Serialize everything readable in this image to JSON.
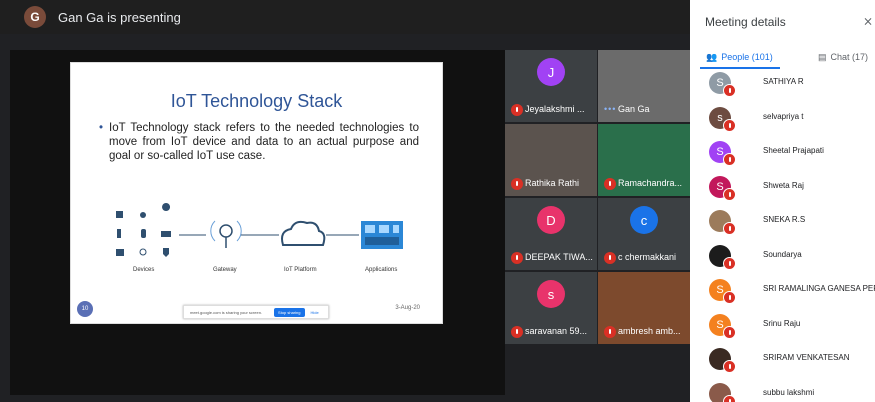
{
  "presenter": {
    "initial": "G",
    "text": "Gan Ga is presenting"
  },
  "slide": {
    "title": "IoT Technology Stack",
    "bullet": "IoT Technology stack refers to the needed technologies to move from IoT device and data to an actual purpose and goal or so-called IoT use case.",
    "labels": {
      "devices": "Devices",
      "gateway": "Gateway",
      "platform": "IoT Platform",
      "applications": "Applications"
    },
    "page_number": "10",
    "date": "3-Aug-20"
  },
  "share_bar": {
    "text": "meet.google.com is sharing your screen.",
    "stop": "Stop sharing",
    "hide": "Hide"
  },
  "tiles": [
    {
      "name": "Jeyalakshmi ...",
      "initial": "J",
      "color": "#a142f4",
      "muted": true
    },
    {
      "name": "Gan Ga",
      "initial": "",
      "color": "#6b6b6b",
      "muted": false,
      "speaking": true
    },
    {
      "name": "Rathika Rathi",
      "initial": "",
      "color": "#5b534e",
      "muted": true
    },
    {
      "name": "Ramachandra...",
      "initial": "",
      "color": "#2a6f4b",
      "muted": true
    },
    {
      "name": "DEEPAK TIWA...",
      "initial": "D",
      "color": "#e8336b",
      "muted": true
    },
    {
      "name": "c chermakkani",
      "initial": "c",
      "color": "#1a73e8",
      "muted": true
    },
    {
      "name": "saravanan 59...",
      "initial": "s",
      "color": "#e8336b",
      "muted": true
    },
    {
      "name": "ambresh amb...",
      "initial": "",
      "color": "#7d4a2d",
      "muted": true
    }
  ],
  "panel": {
    "title": "Meeting details",
    "tabs": {
      "people": "People (101)",
      "chat": "Chat (17)"
    },
    "people": [
      {
        "name": "SATHIYA R",
        "initial": "S",
        "color": "#8f9ba5"
      },
      {
        "name": "selvapriya t",
        "initial": "s",
        "color": "#6d4c41"
      },
      {
        "name": "Sheetal Prajapati",
        "initial": "S",
        "color": "#a142f4"
      },
      {
        "name": "Shweta Raj",
        "initial": "S",
        "color": "#c2185b"
      },
      {
        "name": "SNEKA R.S",
        "initial": "",
        "color": "#9c7b5b"
      },
      {
        "name": "Soundarya",
        "initial": "",
        "color": "#1c1c1c"
      },
      {
        "name": "SRI RAMALINGA GANESA PER",
        "initial": "S",
        "color": "#f4811f"
      },
      {
        "name": "Srinu Raju",
        "initial": "S",
        "color": "#f4811f"
      },
      {
        "name": "SRIRAM VENKATESAN",
        "initial": "",
        "color": "#3a2a22"
      },
      {
        "name": "subbu lakshmi",
        "initial": "",
        "color": "#8a5a4a"
      }
    ]
  }
}
